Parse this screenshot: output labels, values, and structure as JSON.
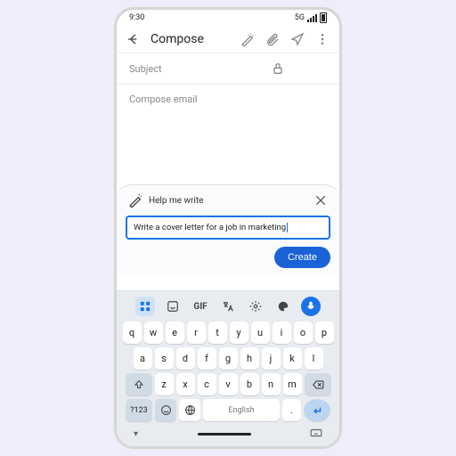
{
  "status": {
    "time": "9:30",
    "net": "5G"
  },
  "topbar": {
    "title": "Compose"
  },
  "subject": {
    "placeholder": "Subject"
  },
  "body": {
    "placeholder": "Compose email"
  },
  "panel": {
    "title": "Help me write",
    "prompt": "Write a cover letter for a job in marketing",
    "create": "Create"
  },
  "keyboard": {
    "gif": "GIF",
    "row1": [
      "q",
      "w",
      "e",
      "r",
      "t",
      "y",
      "u",
      "i",
      "o",
      "p"
    ],
    "row2": [
      "a",
      "s",
      "d",
      "f",
      "g",
      "h",
      "j",
      "k",
      "l"
    ],
    "row3": [
      "z",
      "x",
      "c",
      "v",
      "b",
      "n",
      "m"
    ],
    "sym": "?123",
    "space": "English",
    "comma": ",",
    "period": "."
  }
}
